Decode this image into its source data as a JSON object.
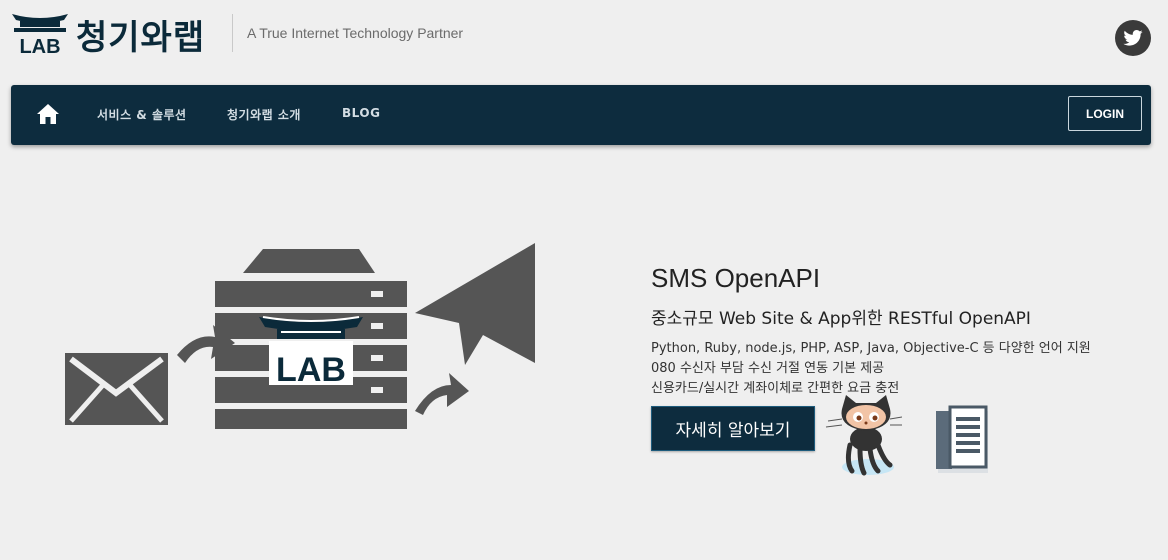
{
  "header": {
    "logo_word": "LAB",
    "logo_text": "청기와랩",
    "tagline": "A True Internet Technology Partner"
  },
  "nav": {
    "items": [
      {
        "label": "서비스 & 솔루션"
      },
      {
        "label": "청기와랩 소개"
      },
      {
        "label": "BLOG"
      }
    ],
    "login_label": "LOGIN"
  },
  "hero": {
    "illustration_lab_label": "LAB",
    "title": "SMS OpenAPI",
    "subtitle": "중소규모 Web Site & App위한 RESTful OpenAPI",
    "features": [
      "Python, Ruby, node.js, PHP, ASP, Java, Objective-C 등 다양한 언어 지원",
      "080 수신자 부담 수신 거절 연동 기본 제공",
      "신용카드/실시간 계좌이체로 간편한 요금 충전"
    ],
    "cta_label": "자세히 알아보기"
  },
  "icons": {
    "home": "home-icon",
    "twitter": "twitter-icon",
    "envelope": "envelope-icon",
    "server": "server-icon",
    "paper_plane": "paper-plane-icon",
    "octocat": "octocat-icon",
    "document": "document-icon"
  },
  "colors": {
    "navbar": "#0d2c3e",
    "background": "#efefef",
    "illustration": "#555555"
  }
}
